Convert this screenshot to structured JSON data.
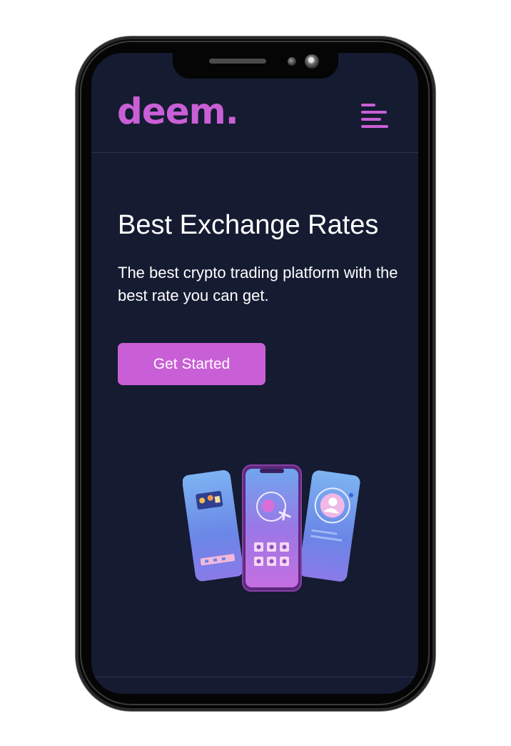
{
  "brand": {
    "logo_text": "deem.",
    "accent_color": "#c95fd6",
    "background_color": "#151b31"
  },
  "header": {
    "menu_icon": "menu-icon"
  },
  "hero": {
    "title": "Best Exchange Rates",
    "description": "The best crypto trading platform with the best rate you can get.",
    "cta_label": "Get Started"
  },
  "illustration": {
    "icon": "phones-illustration"
  }
}
